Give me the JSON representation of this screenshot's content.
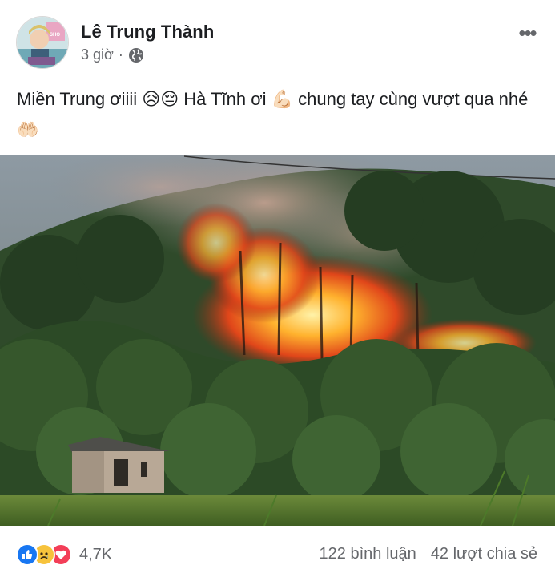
{
  "post": {
    "author": "Lê Trung Thành",
    "time": "3 giờ",
    "separator": "·",
    "text": "Miền Trung ơiiii 😥😔 Hà Tĩnh ơi 💪🏻 chung tay cùng vượt qua nhé 🤲🏻",
    "avatar_sign_text": "SHO"
  },
  "reactions": {
    "count": "4,7K",
    "types": [
      "like",
      "sad",
      "love"
    ]
  },
  "stats": {
    "comments": "122 bình luận",
    "shares": "42 lượt chia sẻ"
  },
  "colors": {
    "text": "#1c1e21",
    "secondary": "#65676b",
    "like": "#1877f2",
    "love": "#f33e58",
    "sad": "#f7c33c"
  },
  "icons": [
    "globe-icon",
    "more-options-icon",
    "like-reaction-icon",
    "sad-reaction-icon",
    "love-reaction-icon"
  ]
}
